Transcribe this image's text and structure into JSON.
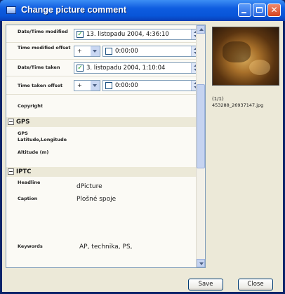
{
  "window": {
    "title": "Change picture comment"
  },
  "fields": {
    "datetime_modified": {
      "label": "Date/Time modified",
      "value": "13. listopadu 2004,   4:36:10"
    },
    "time_modified_offset": {
      "label": "Time modified offset",
      "sign": "+",
      "value": "0:00:00"
    },
    "datetime_taken": {
      "label": "Date/Time taken",
      "value": "3. listopadu 2004,   1:10:04"
    },
    "time_taken_offset": {
      "label": "Time taken offset",
      "sign": "+",
      "value": "0:00:00"
    },
    "copyright": {
      "label": "Copyright",
      "value": ""
    }
  },
  "gps": {
    "category": "GPS",
    "gps_label": "GPS",
    "latlong_label": "Latitude,Longitude",
    "altitude_label": "Altitude (m)"
  },
  "iptc": {
    "category": "IPTC",
    "headline_label": "Headline",
    "headline_value": "dPicture",
    "caption_label": "Caption",
    "caption_value": "Plošné spoje",
    "keywords_label": "Keywords",
    "keywords_value": "AP, technika, PS,"
  },
  "preview": {
    "index": "(1/1)",
    "filename": "453288_26937147.jpg"
  },
  "buttons": {
    "save": "Save",
    "close": "Close"
  },
  "colors": {
    "titlebar": "#0855d8",
    "checkbox": "#21a121"
  }
}
